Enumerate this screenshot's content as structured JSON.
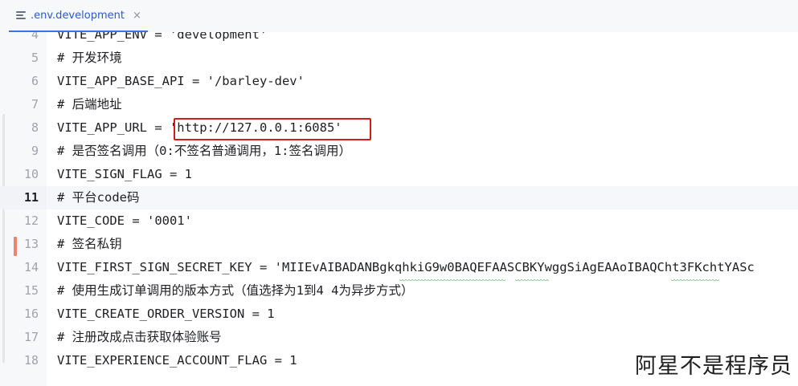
{
  "tab": {
    "title": ".env.development",
    "icon": "text-file-icon",
    "close_glyph": "×"
  },
  "editor": {
    "current_line": "11",
    "highlighted_line": "8",
    "lines": [
      {
        "num": "4",
        "text": "VITE_APP_ENV = 'development'"
      },
      {
        "num": "5",
        "text": "# 开发环境"
      },
      {
        "num": "6",
        "text": "VITE_APP_BASE_API = '/barley-dev'"
      },
      {
        "num": "7",
        "text": "# 后端地址"
      },
      {
        "num": "8",
        "text": "VITE_APP_URL = 'http://127.0.0.1:6085'"
      },
      {
        "num": "9",
        "text": "# 是否签名调用（0:不签名普通调用，1:签名调用）"
      },
      {
        "num": "10",
        "text": "VITE_SIGN_FLAG = 1"
      },
      {
        "num": "11",
        "text": "# 平台code码"
      },
      {
        "num": "12",
        "text": "VITE_CODE = '0001'"
      },
      {
        "num": "13",
        "text": "# 签名私钥"
      },
      {
        "num": "14",
        "text": "VITE_FIRST_SIGN_SECRET_KEY = 'MIIEvAIBADANBgkqhkiG9w0BAQEFAASCBKYwggSiAgEAAoIBAQCht3FKchtYASc"
      },
      {
        "num": "15",
        "text": "# 使用生成订单调用的版本方式（值选择为1到4 4为异步方式）"
      },
      {
        "num": "16",
        "text": "VITE_CREATE_ORDER_VERSION = 1"
      },
      {
        "num": "17",
        "text": "# 注册改成点击获取体验账号"
      },
      {
        "num": "18",
        "text": "VITE_EXPERIENCE_ACCOUNT_FLAG = 1"
      }
    ]
  },
  "watermark": "阿星不是程序员",
  "colors": {
    "accent": "#3574f0",
    "highlight_box": "#d61a1a",
    "change_marker": "#f0846a",
    "typo_squiggle": "#3fa550"
  }
}
